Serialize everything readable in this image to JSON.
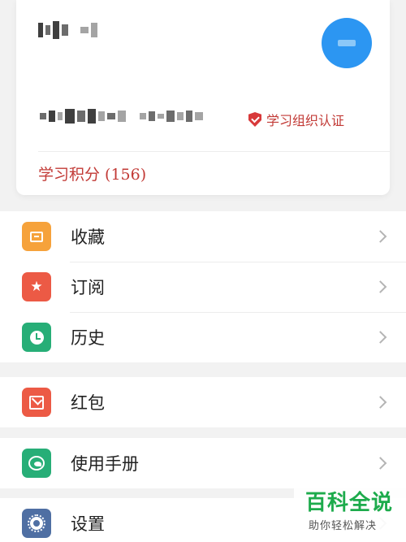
{
  "profile": {
    "certification_label": "学习组织认证",
    "points_label": "学习积分 (156)"
  },
  "menu": {
    "groups": [
      [
        {
          "label": "收藏",
          "icon": "favorites-box-icon",
          "color": "#f6a23b"
        },
        {
          "label": "订阅",
          "icon": "star-icon",
          "color": "#ec5a45"
        },
        {
          "label": "历史",
          "icon": "clock-icon",
          "color": "#27ae77"
        }
      ],
      [
        {
          "label": "红包",
          "icon": "red-envelope-icon",
          "color": "#ec5a45"
        }
      ],
      [
        {
          "label": "使用手册",
          "icon": "manual-icon",
          "color": "#27ae77"
        }
      ],
      [
        {
          "label": "设置",
          "icon": "gear-icon",
          "color": "#4f6fa3"
        }
      ]
    ]
  },
  "watermark": {
    "title": "百科全说",
    "subtitle": "助你轻松解决"
  }
}
